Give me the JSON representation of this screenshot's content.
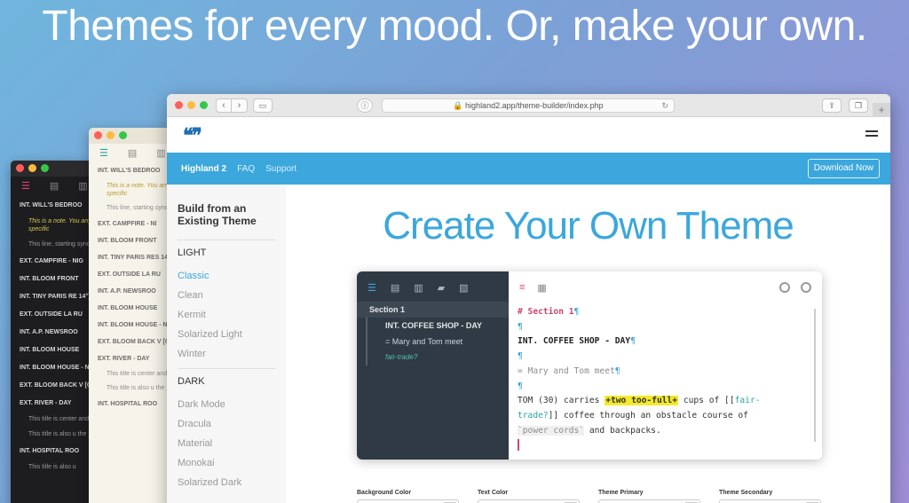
{
  "hero": {
    "title": "Themes for every mood. Or, make your own."
  },
  "dark_window": {
    "items": [
      {
        "kind": "scene",
        "text": "INT. WILL'S BEDROO"
      },
      {
        "kind": "note",
        "text": "This is a note. You anywhere. Like syn unless you specific"
      },
      {
        "kind": "text",
        "text": "This line, starting synopsis. They do specifically want t"
      },
      {
        "kind": "scene",
        "text": "EXT. CAMPFIRE - NIG"
      },
      {
        "kind": "scene",
        "text": "INT. BLOOM FRONT"
      },
      {
        "kind": "scene",
        "text": "INT. TINY PARIS RE 14°) - NIGHT (1998)"
      },
      {
        "kind": "scene",
        "text": "EXT. OUTSIDE LA RU"
      },
      {
        "kind": "scene",
        "text": "INT. A.P. NEWSROO"
      },
      {
        "kind": "scene",
        "text": "INT. BLOOM HOUSE"
      },
      {
        "kind": "scene",
        "text": "INT. BLOOM HOUSE - NIGHT"
      },
      {
        "kind": "scene",
        "text": "EXT. BLOOM BACK V [CONTINUOUS]"
      },
      {
        "kind": "scene",
        "text": "EXT. RIVER - DAY"
      },
      {
        "kind": "text",
        "text": "This title is center and <, or choose f"
      },
      {
        "kind": "text",
        "text": "This title is also u the _ and _ or cho"
      },
      {
        "kind": "scene",
        "text": "INT. HOSPITAL ROO"
      },
      {
        "kind": "text",
        "text": "This title is also u"
      }
    ]
  },
  "light_window": {
    "items": [
      {
        "kind": "scene",
        "text": "INT. WILL'S BEDROO"
      },
      {
        "kind": "note",
        "text": "This is a note. You anywhere. Like sy unless you specific"
      },
      {
        "kind": "text",
        "text": "This line, starting synopsis. They do specifically want t"
      },
      {
        "kind": "scene",
        "text": "EXT. CAMPFIRE - NI"
      },
      {
        "kind": "scene",
        "text": "INT. BLOOM FRONT"
      },
      {
        "kind": "scene",
        "text": "INT. TINY PARIS RES 14°) - NIGHT (1998"
      },
      {
        "kind": "scene",
        "text": "EXT. OUTSIDE LA RU"
      },
      {
        "kind": "scene",
        "text": "INT. A.P. NEWSROO"
      },
      {
        "kind": "scene",
        "text": "INT. BLOOM HOUSE"
      },
      {
        "kind": "scene",
        "text": "INT. BLOOM HOUSE - NIGHT"
      },
      {
        "kind": "scene",
        "text": "EXT. BLOOM BACK V [CONTINUOUS]"
      },
      {
        "kind": "scene",
        "text": "EXT. RIVER - DAY"
      },
      {
        "kind": "text",
        "text": "This title is center and <, or choose f"
      },
      {
        "kind": "text",
        "text": "This title is also u the _ and _ or cho"
      },
      {
        "kind": "scene",
        "text": "INT. HOSPITAL ROO"
      }
    ]
  },
  "browser": {
    "url": "highland2.app/theme-builder/index.php",
    "nav_back": "‹",
    "nav_forward": "›"
  },
  "site": {
    "logo": "❝❞",
    "nav": {
      "brand": "Highland 2",
      "faq": "FAQ",
      "support": "Support",
      "download": "Download Now"
    },
    "sidebar": {
      "title": "Build from an Existing Theme",
      "light_heading": "LIGHT",
      "light_items": [
        "Classic",
        "Clean",
        "Kermit",
        "Solarized Light",
        "Winter"
      ],
      "dark_heading": "DARK",
      "dark_items": [
        "Dark Mode",
        "Dracula",
        "Material",
        "Monokai",
        "Solarized Dark"
      ]
    },
    "main_title": "Create Your Own Theme",
    "editor": {
      "outline": {
        "section": "Section 1",
        "scene": "INT. COFFEE SHOP - DAY",
        "synopsis": "= Mary and Tom meet",
        "tag": "fair-trade?"
      },
      "code": {
        "heading": "# Section 1",
        "pilcrow": "¶",
        "scene": "INT. COFFEE SHOP - DAY",
        "synopsis": "= Mary and Tom meet",
        "line1_a": "TOM (30) carries ",
        "line1_hl": "+two too-full+",
        "line1_b": " cups of [[",
        "note_a": "fair-",
        "note_b": "trade?",
        "line2_b": "]] coffee through an obstacle course of",
        "code_span": "`power cords`",
        "line3_b": " and backpacks."
      }
    },
    "colors": [
      {
        "label": "Background Color",
        "swatch": "#ffffff"
      },
      {
        "label": "Text Color",
        "swatch": "#333333"
      },
      {
        "label": "Theme Primary",
        "swatch": "#c8466a"
      },
      {
        "label": "Theme Secondary",
        "swatch": "#3ba7dc"
      }
    ]
  }
}
